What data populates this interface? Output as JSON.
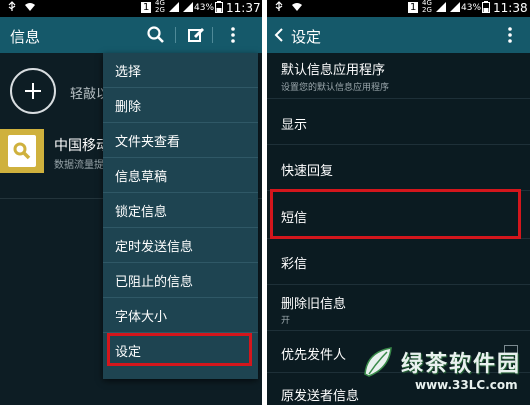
{
  "left_screen": {
    "status_bar": {
      "sim": "1",
      "net_top": "4G",
      "net_bottom": "2G",
      "battery": "43%",
      "time": "11:37"
    },
    "action_bar": {
      "title": "信息"
    },
    "compose_hint": "轻敲以",
    "conversation": {
      "name": "中国移动",
      "preview": "数据流量提"
    },
    "menu": {
      "items": [
        "选择",
        "删除",
        "文件夹查看",
        "信息草稿",
        "锁定信息",
        "定时发送信息",
        "已阻止的信息",
        "字体大小",
        "设定"
      ],
      "highlighted": "设定"
    }
  },
  "right_screen": {
    "status_bar": {
      "sim": "1",
      "net_top": "4G",
      "net_bottom": "2G",
      "battery": "43%",
      "time": "11:38"
    },
    "action_bar": {
      "title": "设定"
    },
    "settings": [
      {
        "title": "默认信息应用程序",
        "subtitle": "设置您的默认信息应用程序"
      },
      {
        "title": "显示"
      },
      {
        "title": "快速回复"
      },
      {
        "title": "短信"
      },
      {
        "title": "彩信"
      },
      {
        "title": "删除旧信息",
        "subtitle": "开"
      },
      {
        "title": "优先发件人"
      },
      {
        "title": "原发送者信息"
      }
    ],
    "highlighted": "短信"
  },
  "watermark": {
    "title": "绿茶软件园",
    "url": "www.33LC.com"
  },
  "colors": {
    "action_bar": "#15596a",
    "menu_bg": "#1e4451",
    "highlight": "#d4161c",
    "background": "#0b1b21"
  }
}
